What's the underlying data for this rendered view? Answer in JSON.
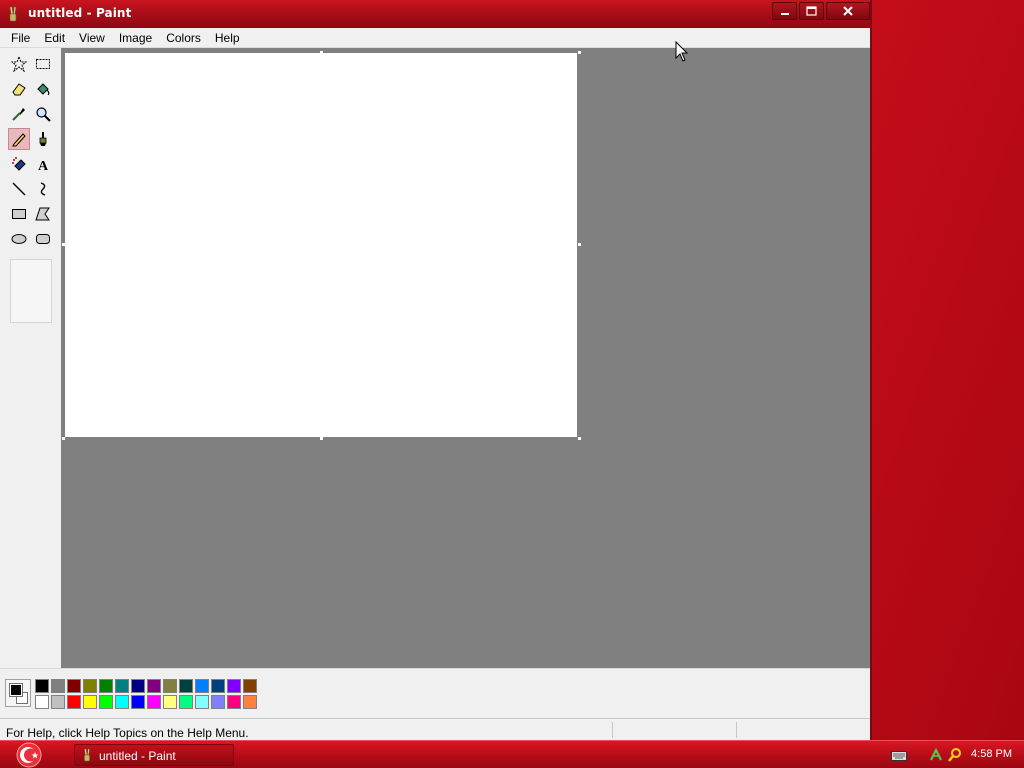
{
  "window": {
    "title": "untitled - Paint",
    "icon": "paint-brush-icon",
    "controls": [
      "minimize-icon",
      "maximize-icon",
      "close-icon"
    ]
  },
  "menu": {
    "items": [
      "File",
      "Edit",
      "View",
      "Image",
      "Colors",
      "Help"
    ]
  },
  "tools": [
    {
      "name": "free-form-select",
      "icon": "star-select-icon"
    },
    {
      "name": "select",
      "icon": "rect-select-icon"
    },
    {
      "name": "eraser",
      "icon": "eraser-icon"
    },
    {
      "name": "fill-with-color",
      "icon": "paint-bucket-icon"
    },
    {
      "name": "pick-color",
      "icon": "eyedropper-icon"
    },
    {
      "name": "magnifier",
      "icon": "magnifier-icon"
    },
    {
      "name": "pencil",
      "icon": "pencil-icon",
      "selected": true
    },
    {
      "name": "brush",
      "icon": "brush-icon"
    },
    {
      "name": "airbrush",
      "icon": "airbrush-icon"
    },
    {
      "name": "text",
      "icon": "text-icon"
    },
    {
      "name": "line",
      "icon": "line-icon"
    },
    {
      "name": "curve",
      "icon": "curve-icon"
    },
    {
      "name": "rectangle",
      "icon": "rectangle-icon"
    },
    {
      "name": "polygon",
      "icon": "polygon-icon"
    },
    {
      "name": "ellipse",
      "icon": "ellipse-icon"
    },
    {
      "name": "rounded-rectangle",
      "icon": "rounded-rectangle-icon"
    }
  ],
  "palette": {
    "foreground": "#000000",
    "background": "#ffffff",
    "top": [
      "#000000",
      "#808080",
      "#800000",
      "#808000",
      "#008000",
      "#008080",
      "#000080",
      "#800080",
      "#808040",
      "#004040",
      "#0080ff",
      "#004080",
      "#8000ff",
      "#804000"
    ],
    "bottom": [
      "#ffffff",
      "#c0c0c0",
      "#ff0000",
      "#ffff00",
      "#00ff00",
      "#00ffff",
      "#0000ff",
      "#ff00ff",
      "#ffff80",
      "#00ff80",
      "#80ffff",
      "#8080ff",
      "#ff0080",
      "#ff8040"
    ]
  },
  "status": {
    "text": "For Help, click Help Topics on the Help Menu."
  },
  "taskbar": {
    "task_label": "untitled - Paint",
    "clock": "4:58 PM"
  }
}
